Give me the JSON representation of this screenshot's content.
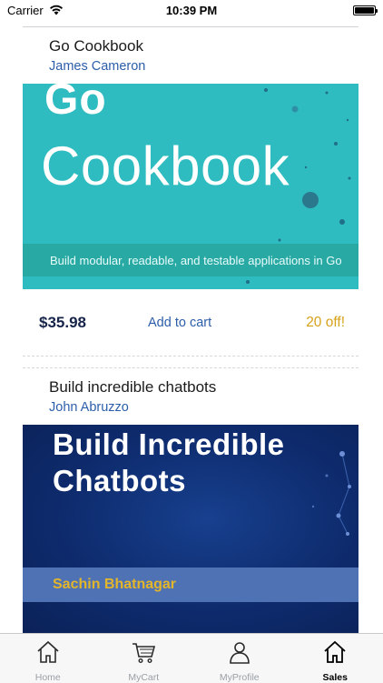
{
  "status_bar": {
    "carrier": "Carrier",
    "time": "10:39 PM",
    "battery_level": 1.0
  },
  "books": [
    {
      "title": "Go Cookbook",
      "author": "James Cameron",
      "cover": {
        "line1": "Go",
        "line2": "Cookbook",
        "subtitle": "Build modular, readable, and testable applications in Go",
        "background": "#2fbcc0"
      },
      "price": "$35.98",
      "add_to_cart": "Add to cart",
      "discount": "20 off!"
    },
    {
      "title": "Build incredible chatbots",
      "author": "John Abruzzo",
      "cover": {
        "line1": "Build Incredible",
        "line2": "Chatbots",
        "author_band": "Sachin Bhatnagar",
        "background": "#0e2b6d"
      }
    }
  ],
  "tabs": [
    {
      "label": "Home",
      "icon": "home-icon",
      "active": false
    },
    {
      "label": "MyCart",
      "icon": "cart-icon",
      "active": false
    },
    {
      "label": "MyProfile",
      "icon": "profile-icon",
      "active": false
    },
    {
      "label": "Sales",
      "icon": "sales-icon",
      "active": true
    }
  ],
  "colors": {
    "accent_link": "#2c5ea8",
    "discount": "#d6a21a",
    "price": "#16244a"
  }
}
